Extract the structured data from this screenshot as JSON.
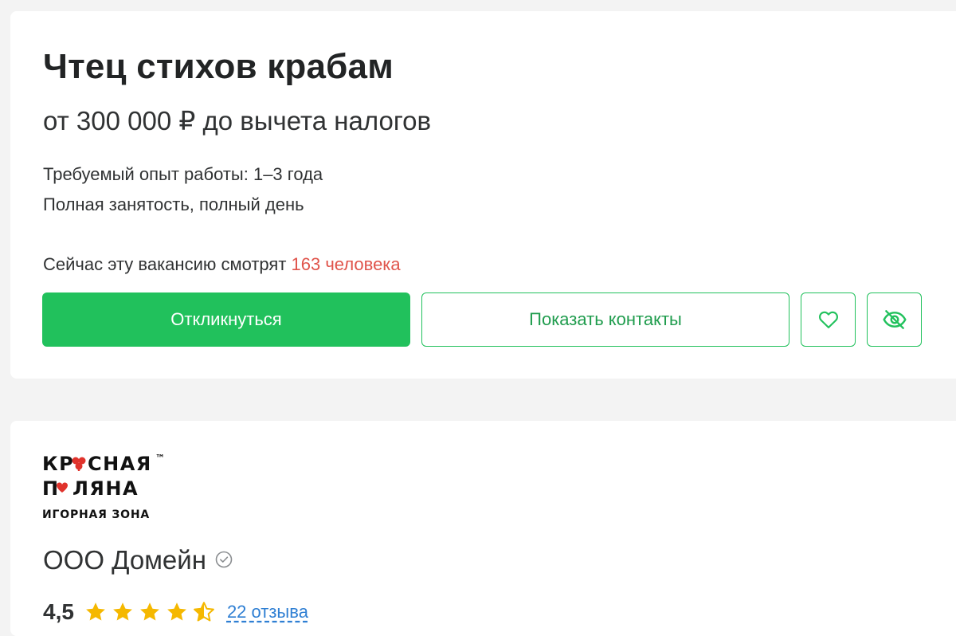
{
  "vacancy": {
    "title": "Чтец стихов крабам",
    "salary": "от 300 000 ₽ до вычета налогов",
    "experience": "Требуемый опыт работы: 1–3 года",
    "employment": "Полная занятость, полный день",
    "watching_prefix": "Сейчас эту вакансию смотрят",
    "watching_count": "163 человека",
    "apply_label": "Откликнуться",
    "contacts_label": "Показать контакты",
    "favorite_icon": "heart-icon",
    "hide_icon": "eye-off-icon"
  },
  "company": {
    "logo": {
      "line1": "КРАСНАЯ",
      "line2": "ПОЛЯНА",
      "line3": "ИГОРНАЯ ЗОНА",
      "tm": "™"
    },
    "name": "ООО Домейн",
    "verified_icon": "check-circle-icon",
    "rating": "4,5",
    "rating_stars": 4.5,
    "reviews_label": "22 отзыва"
  },
  "colors": {
    "accent_green": "#21c15c",
    "watching_red": "#e0544b",
    "link_blue": "#2f7fd3",
    "star_yellow": "#f5b800"
  }
}
